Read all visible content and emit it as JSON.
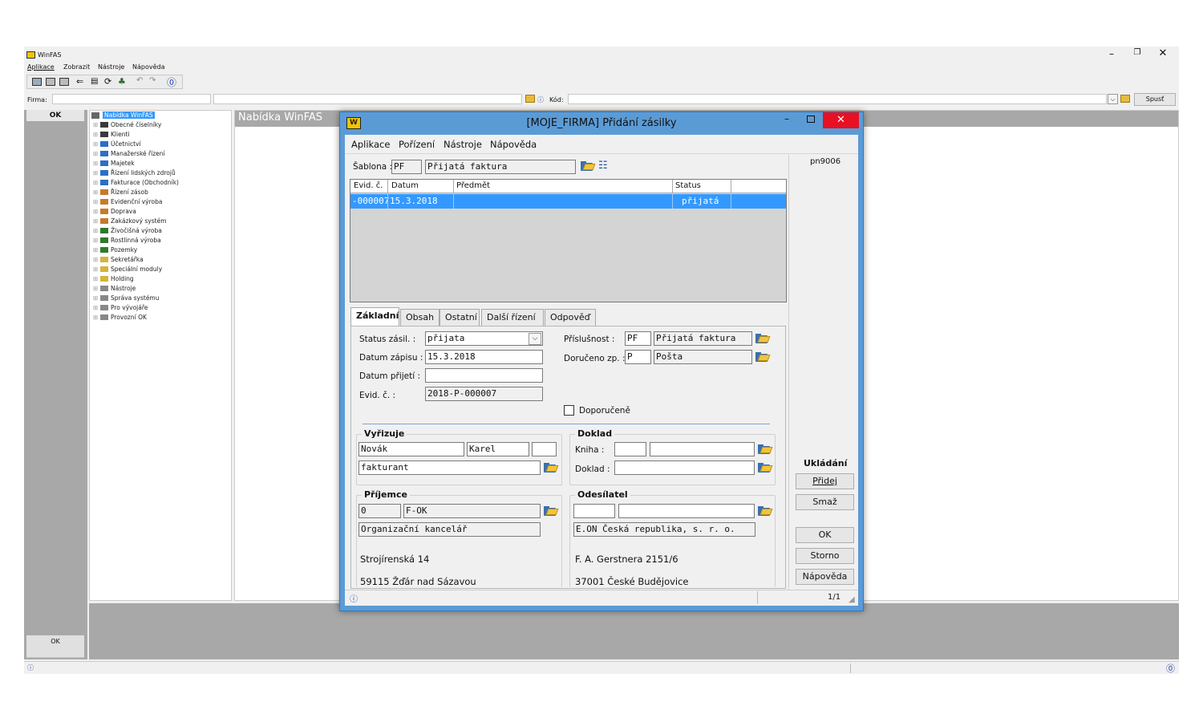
{
  "app": {
    "title": "WinFAS",
    "menu": [
      "Aplikace",
      "Zobrazit",
      "Nástroje",
      "Nápověda"
    ],
    "firma_label": "Firma:",
    "kod_label": "Kód:",
    "spust_label": "Spusť",
    "ok_label": "OK",
    "ok_bottom_label": "OK",
    "panel_title": "Nabídka WinFAS"
  },
  "tree": {
    "root": "Nabídka WinFAS",
    "items": [
      {
        "label": "Obecné číselníky",
        "color": "#3a3a3a"
      },
      {
        "label": "Klienti",
        "color": "#3a3a3a"
      },
      {
        "label": "Účetnictví",
        "color": "#2c6fc4"
      },
      {
        "label": "Manažerské řízení",
        "color": "#2c6fc4"
      },
      {
        "label": "Majetek",
        "color": "#2c6fc4"
      },
      {
        "label": "Řízení lidských zdrojů",
        "color": "#2c6fc4"
      },
      {
        "label": "Fakturace (Obchodník)",
        "color": "#2c6fc4"
      },
      {
        "label": "Řízení zásob",
        "color": "#c77a2b"
      },
      {
        "label": "Evidenční výroba",
        "color": "#c77a2b"
      },
      {
        "label": "Doprava",
        "color": "#c77a2b"
      },
      {
        "label": "Zakázkový systém",
        "color": "#c77a2b"
      },
      {
        "label": "Živočišná výroba",
        "color": "#2f7a2f"
      },
      {
        "label": "Rostlinná výroba",
        "color": "#2f7a2f"
      },
      {
        "label": "Pozemky",
        "color": "#2f7a2f"
      },
      {
        "label": "Sekretářka",
        "color": "#d4b43a"
      },
      {
        "label": "Speciální moduly",
        "color": "#d4b43a"
      },
      {
        "label": "Holding",
        "color": "#d4b43a"
      },
      {
        "label": "Nástroje",
        "color": "#888888"
      },
      {
        "label": "Správa systému",
        "color": "#888888"
      },
      {
        "label": "Pro vývojáře",
        "color": "#888888"
      },
      {
        "label": "Provozní OK",
        "color": "#888888"
      }
    ]
  },
  "dialog": {
    "title": "[MOJE_FIRMA] Přidání zásilky",
    "menu": [
      "Aplikace",
      "Pořízení",
      "Nástroje",
      "Nápověda"
    ],
    "code": "pn9006",
    "sablona_label": "Šablona :",
    "sablona_code": "PF",
    "sablona_name": "Přijatá faktura",
    "grid": {
      "headers": [
        "Evid. č.",
        "Datum",
        "Předmět",
        "Status"
      ],
      "rows": [
        [
          "-000007",
          "15.3.2018",
          "",
          "přijatá"
        ]
      ]
    },
    "tabs": [
      "Základní",
      "Obsah",
      "Ostatní",
      "Další řízení",
      "Odpověď"
    ],
    "fields": {
      "status_label": "Status zásil. :",
      "status_value": "přijata",
      "datum_zapisu_label": "Datum zápisu :",
      "datum_zapisu_value": "15.3.2018",
      "datum_prijeti_label": "Datum přijetí :",
      "datum_prijeti_value": "",
      "evid_label": "Evid. č. :",
      "evid_value": "2018-P-000007",
      "prislusnost_label": "Příslušnost :",
      "prislusnost_code": "PF",
      "prislusnost_name": "Přijatá faktura",
      "doruceno_label": "Doručeno zp. :",
      "doruceno_code": "P",
      "doruceno_name": "Pošta",
      "doporucene_label": "Doporučeně"
    },
    "vyrizuje": {
      "title": "Vyřizuje",
      "surname": "Novák",
      "name": "Karel",
      "extra": "",
      "role": "fakturant"
    },
    "doklad": {
      "title": "Doklad",
      "kniha_label": "Kniha :",
      "doklad_label": "Doklad :"
    },
    "prijemce": {
      "title": "Příjemce",
      "code": "0",
      "org_code": "F-OK",
      "org_name": "Organizační kancelář",
      "street": "Strojírenská 14",
      "city": "59115 Žďár nad Sázavou"
    },
    "odesilatel": {
      "title": "Odesílatel",
      "name": "E.ON Česká republika, s. r. o.",
      "street": "F. A. Gerstnera 2151/6",
      "city": "37001 České Budějovice"
    },
    "side": {
      "ukladani": "Ukládání",
      "pridej": "Přidej",
      "smaz": "Smaž",
      "ok": "OK",
      "storno": "Storno",
      "napoveda": "Nápověda"
    },
    "status_bar_page": "1/1"
  },
  "colors": {
    "selection": "#3399ff",
    "titlebar": "#5b9bd5",
    "close": "#e81123"
  }
}
